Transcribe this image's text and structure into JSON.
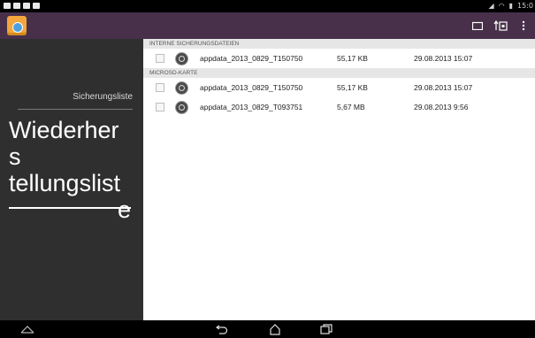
{
  "status": {
    "time": "15:0"
  },
  "actions": [
    "new-folder-icon",
    "restore-icon",
    "overflow-menu-icon"
  ],
  "sidebar": {
    "label": "Sicherungsliste",
    "title_lines": [
      "Wiederhers",
      "tellungslist",
      "e"
    ]
  },
  "sections": [
    {
      "title": "INTERNE SICHERUNGSDATEIEN",
      "files": [
        {
          "name": "appdata_2013_0829_T150750",
          "size": "55,17 KB",
          "date": "29.08.2013 15:07"
        }
      ]
    },
    {
      "title": "MICROSD-KARTE",
      "files": [
        {
          "name": "appdata_2013_0829_T150750",
          "size": "55,17 KB",
          "date": "29.08.2013 15:07"
        },
        {
          "name": "appdata_2013_0829_T093751",
          "size": "5,67 MB",
          "date": "29.08.2013 9:56"
        }
      ]
    }
  ]
}
